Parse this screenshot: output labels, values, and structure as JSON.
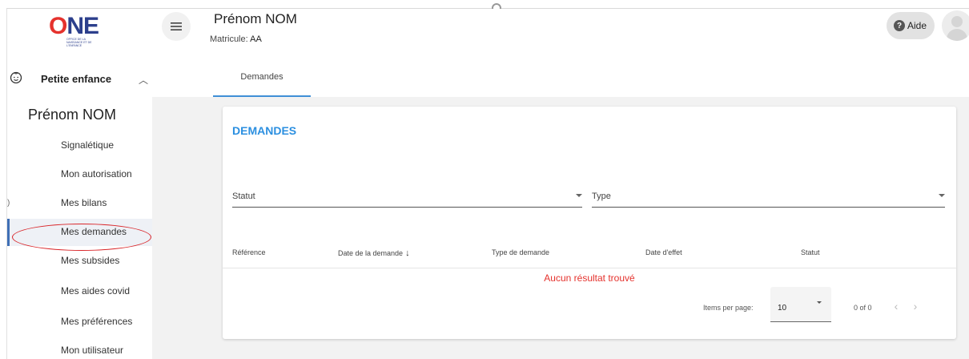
{
  "logo": {
    "word_o": "O",
    "word_ne": "NE",
    "subtitle": "OFFICE DE LA NAISSANCE ET DE L'ENFANCE"
  },
  "sidebar": {
    "section_title": "Petite enfance",
    "person_name": "Prénom NOM",
    "items": [
      {
        "label": "Signalétique"
      },
      {
        "label": "Mon autorisation"
      },
      {
        "label": "Mes bilans"
      },
      {
        "label": "Mes demandes",
        "active": true
      },
      {
        "label": "Mes subsides"
      },
      {
        "label": "Mes aides covid"
      },
      {
        "label": "Mes préférences"
      },
      {
        "label": "Mon utilisateur"
      }
    ]
  },
  "header": {
    "name": "Prénom NOM",
    "matricule_label": "Matricule:",
    "matricule_value": "AA",
    "help_label": "Aide",
    "tab_label": "Demandes"
  },
  "card": {
    "title": "DEMANDES",
    "filter_statut": "Statut",
    "filter_type": "Type",
    "columns": [
      "Référence",
      "Date de la demande",
      "Type de demande",
      "Date d'effet",
      "Statut"
    ],
    "empty_message": "Aucun résultat trouvé",
    "items_per_page_label": "Items per page:",
    "items_per_page_value": "10",
    "range_label": "0 of 0"
  },
  "colors": {
    "accent_blue": "#2b8fe0",
    "empty_red": "#e5322d",
    "active_border": "#3f6fb5",
    "annotation_red": "#d9262a"
  },
  "icons": [
    "menu-icon",
    "help-circle-icon",
    "user-avatar-icon",
    "baby-face-icon",
    "chevron-up-icon",
    "arrow-down-icon",
    "chevron-left-icon",
    "chevron-right-icon",
    "dropdown-caret-icon"
  ]
}
